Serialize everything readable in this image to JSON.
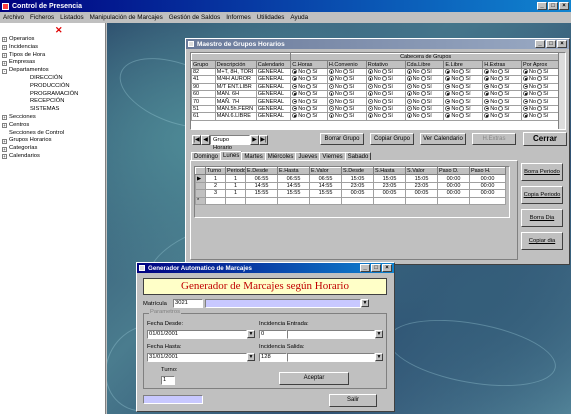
{
  "app": {
    "title": "Control de Presencia",
    "menu": [
      "Archivo",
      "Ficheros",
      "Listados",
      "Manipulación de Marcajes",
      "Gestión de Saldos",
      "Informes",
      "Utilidades",
      "Ayuda"
    ],
    "controls": [
      "_",
      "□",
      "×"
    ]
  },
  "tree": {
    "close_glyph": "✕",
    "items": [
      {
        "label": "Operarios",
        "exp": "+",
        "indent": 0
      },
      {
        "label": "Incidencias",
        "exp": "+",
        "indent": 0
      },
      {
        "label": "Tipos de Hora",
        "exp": "+",
        "indent": 0
      },
      {
        "label": "Empresas",
        "exp": "+",
        "indent": 0
      },
      {
        "label": "Departamentos",
        "exp": "-",
        "indent": 0
      },
      {
        "label": "DIRECCIÓN",
        "exp": "",
        "indent": 1
      },
      {
        "label": "PRODUCCIÓN",
        "exp": "",
        "indent": 1
      },
      {
        "label": "PROGRAMACIÓN",
        "exp": "",
        "indent": 1
      },
      {
        "label": "RECEPCIÓN",
        "exp": "",
        "indent": 1
      },
      {
        "label": "SISTEMAS",
        "exp": "",
        "indent": 1
      },
      {
        "label": "Secciones",
        "exp": "+",
        "indent": 0
      },
      {
        "label": "Centros",
        "exp": "+",
        "indent": 0
      },
      {
        "label": "Secciones de Control",
        "exp": "",
        "indent": 0
      },
      {
        "label": "Grupos Horarios",
        "exp": "+",
        "indent": 0
      },
      {
        "label": "Categorías",
        "exp": "+",
        "indent": 0
      },
      {
        "label": "Calendarios",
        "exp": "+",
        "indent": 0
      }
    ]
  },
  "maestro": {
    "title": "Maestro de Grupos Horarios",
    "group_header": "Cabecera de Grupos",
    "columns": [
      "Grupo",
      "Descripción",
      "Calendario",
      "C.Horas",
      "H.Convenio",
      "Rotativo",
      "Cda.Libre",
      "E.Libre",
      "H.Extras",
      "Por Aprox"
    ],
    "rows": [
      {
        "grupo": "82",
        "desc": "M+T, 8H, TORI",
        "cal": "GENERAL"
      },
      {
        "grupo": "41",
        "desc": "M/4H AUROR",
        "cal": "GENERAL"
      },
      {
        "grupo": "90",
        "desc": "M/T ENT.LIBR",
        "cal": "GENERAL"
      },
      {
        "grupo": "60",
        "desc": "MAÑ. 6H",
        "cal": "GENERAL"
      },
      {
        "grupo": "70",
        "desc": "MAÑ. 7H",
        "cal": "GENERAL"
      },
      {
        "grupo": "51",
        "desc": "MAÑ.5h.FERN",
        "cal": "GENERAL"
      },
      {
        "grupo": "61",
        "desc": "MAÑ.6.LIBRE",
        "cal": "GENERAL"
      }
    ],
    "radio_no": "No",
    "radio_si": "Sí",
    "nav_label": "Grupo Horario",
    "buttons": {
      "borrar": "Borrar Grupo",
      "copiar": "Copiar Grupo",
      "ver_cal": "Ver Calendario",
      "hextras": "H.Extras",
      "cerrar": "Cerrar"
    },
    "tabs": [
      "Domingo",
      "Lunes",
      "Martes",
      "Miércoles",
      "Jueves",
      "Viernes",
      "Sabado"
    ],
    "active_tab": "Lunes",
    "period_columns": [
      "Turno",
      "Periodo",
      "E.Desde",
      "E.Hasta",
      "E.Valor",
      "S.Desde",
      "S.Hasta",
      "S.Valor",
      "Paso D.",
      "Paso H."
    ],
    "periods": [
      [
        "1",
        "1",
        "06:55",
        "06:55",
        "06:55",
        "15:05",
        "15:05",
        "15:05",
        "00:00",
        "00:00"
      ],
      [
        "2",
        "1",
        "14:55",
        "14:55",
        "14:55",
        "23:05",
        "23:05",
        "23:05",
        "00:00",
        "00:00"
      ],
      [
        "3",
        "1",
        "15:55",
        "15:55",
        "15:55",
        "00:05",
        "00:05",
        "00:05",
        "00:00",
        "00:00"
      ]
    ],
    "side_buttons": [
      "Borra Periodo",
      "Copia Periodo",
      "Borra Dia",
      "Copiar dia"
    ]
  },
  "generador": {
    "title": "Generador Automatico de Marcajes",
    "header": "Generador de Marcajes según Horario",
    "matricula_label": "Matrícula",
    "matricula_value": "3021",
    "params_label": "Parametros",
    "fecha_desde_label": "Fecha Desde:",
    "fecha_desde": "01/01/2001",
    "inc_entrada_label": "Incidencia Entrada:",
    "inc_entrada": "0",
    "fecha_hasta_label": "Fecha Hasta:",
    "fecha_hasta": "31/01/2001",
    "inc_salida_label": "Incidencia Salida:",
    "inc_salida": "128",
    "turno_label": "Turno:",
    "turno": "1",
    "aceptar": "Aceptar",
    "salir": "Salir"
  },
  "colors": {
    "title_active": "#000080",
    "gen_header_bg": "#ffffc8",
    "gen_header_text": "#c00000",
    "matricula_highlight": "#c8c8ff"
  }
}
